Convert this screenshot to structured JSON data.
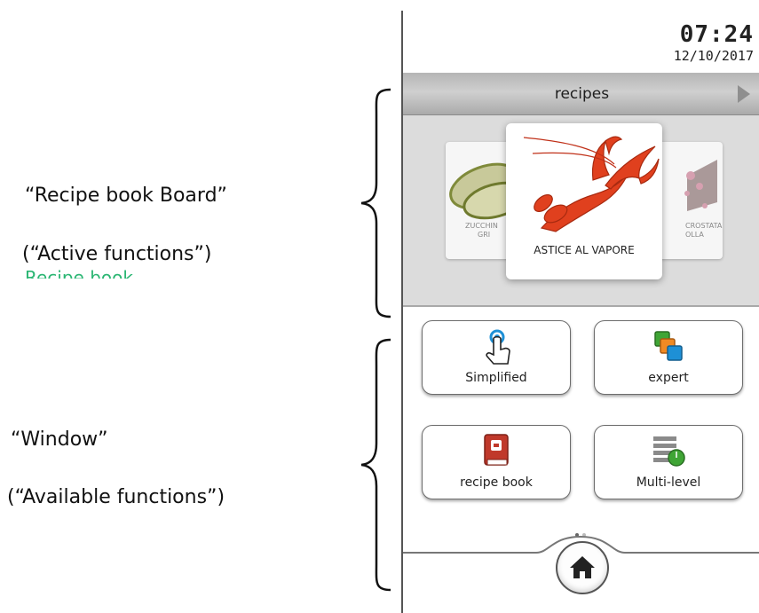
{
  "annotations": {
    "board_title": "“Recipe book Board”",
    "board_subtitle": "(“Active functions”)",
    "board_partial": "Recipe book",
    "window_title": "“Window”",
    "window_subtitle": "(“Available functions”)"
  },
  "status": {
    "time": "07:24",
    "date": "12/10/2017"
  },
  "header": {
    "title": "recipes",
    "next_icon": "play-arrow-icon"
  },
  "recipes": {
    "left_card": {
      "label_line1": "ZUCCHIN",
      "label_line2": "GRI"
    },
    "main_card": {
      "label": "ASTICE AL VAPORE"
    },
    "right_card": {
      "label_line1": "CROSTATA",
      "label_line2": "OLLA"
    }
  },
  "functions": [
    {
      "label": "Simplified",
      "icon": "touch-hand-icon"
    },
    {
      "label": "expert",
      "icon": "stacked-squares-icon"
    },
    {
      "label": "recipe book",
      "icon": "recipe-book-icon"
    },
    {
      "label": "Multi-level",
      "icon": "multi-level-trays-icon"
    }
  ],
  "pager": {
    "current": 1,
    "total": 2
  },
  "colors": {
    "accent_blue": "#1e90d6",
    "green": "#3fa535",
    "orange": "#f08a24",
    "book_red": "#c0392b",
    "annotation_green": "#2bb673"
  }
}
